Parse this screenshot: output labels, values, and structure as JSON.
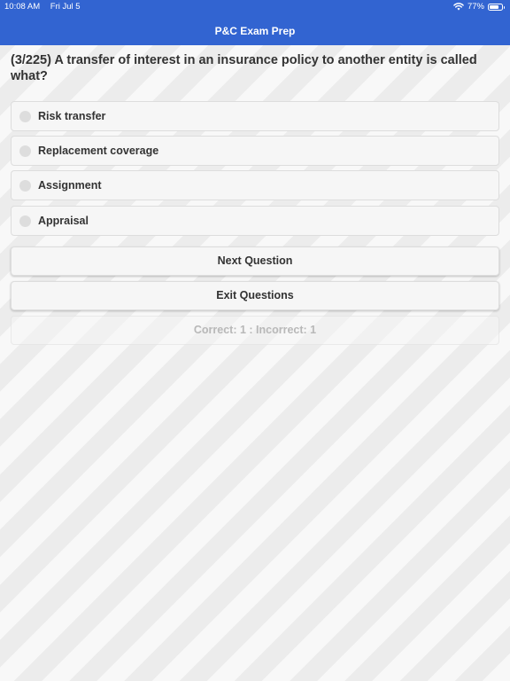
{
  "status_bar": {
    "time": "10:08 AM",
    "date": "Fri Jul 5",
    "battery_percent": "77%",
    "battery_level": 0.77
  },
  "nav": {
    "title": "P&C Exam Prep"
  },
  "question": {
    "text": "(3/225) A transfer of interest in an insurance policy to another entity is called what?"
  },
  "options": [
    {
      "label": "Risk transfer",
      "selected": false
    },
    {
      "label": "Replacement coverage",
      "selected": false
    },
    {
      "label": "Assignment",
      "selected": false
    },
    {
      "label": "Appraisal",
      "selected": false
    }
  ],
  "buttons": {
    "next_label": "Next Question",
    "exit_label": "Exit Questions"
  },
  "score": {
    "text": "Correct: 1 : Incorrect: 1"
  },
  "colors": {
    "header": "#3264d1",
    "text": "#333333",
    "muted_text": "#b8b8b8"
  }
}
